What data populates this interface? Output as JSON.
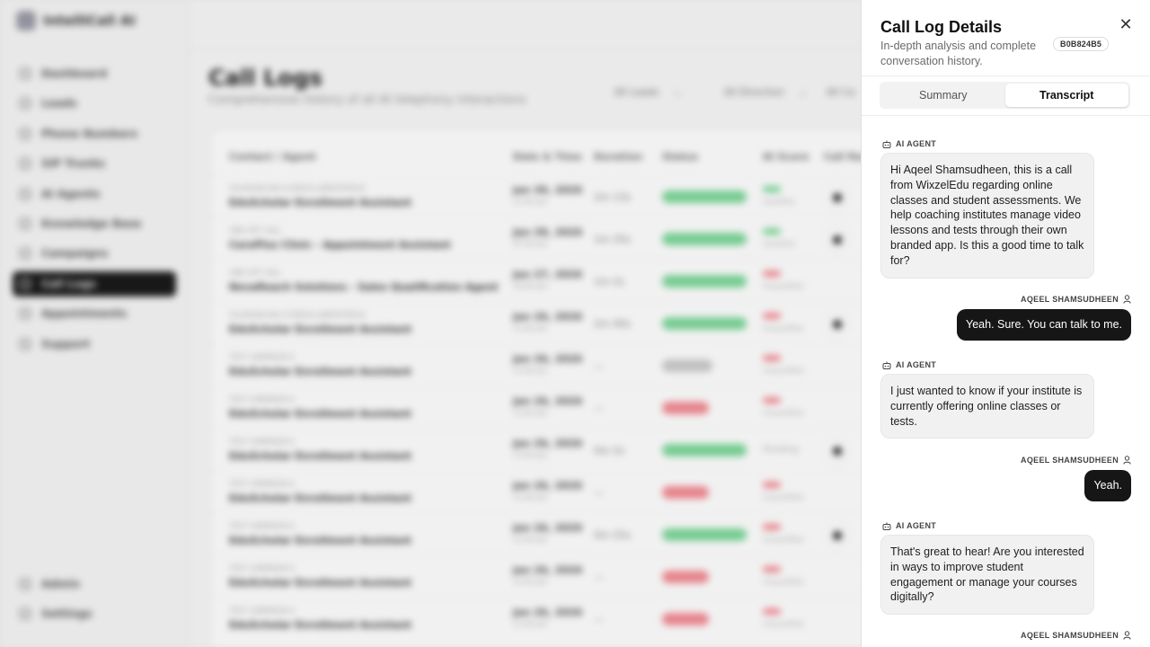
{
  "background": {
    "brand": "IntelliCall AI",
    "nav": [
      "Dashboard",
      "Leads",
      "Phone Numbers",
      "SIP Trunks",
      "AI Agents",
      "Knowledge Base",
      "Campaigns",
      "Call Logs",
      "Appointments",
      "Support"
    ],
    "nav_active_index": 7,
    "nav_bottom": [
      "Admin",
      "Settings"
    ],
    "page_title": "Call Logs",
    "page_subtitle": "Comprehensive history of all AI telephony interactions",
    "filters": [
      "All Leads",
      "All Direction",
      "All Ca"
    ],
    "table_headers": [
      "Contact / Agent",
      "Date & Time",
      "Duration",
      "Status",
      "AI Score",
      "Call Rec"
    ],
    "rows": [
      {
        "contact": "SOUDHAVLAN (CONSOLLANDOFDEUD",
        "agent": "EduScholar Enrollment Assistant",
        "date": "Jan 30, 2026",
        "time": "11:42 pm",
        "duration": "2m 13s",
        "status": "ok",
        "score": "g",
        "rec": true
      },
      {
        "contact": "ONE-OFF CALL",
        "agent": "CarePlus Clinic - Appointment Assistant",
        "date": "Jan 28, 2026",
        "time": "07:55 pm",
        "duration": "1m 35s",
        "status": "ok",
        "score": "g",
        "rec": true
      },
      {
        "contact": "ONE-OFF CALL",
        "agent": "NovaReach Solutions - Sales Qualification Agent",
        "date": "Jan 27, 2026",
        "time": "10:45 pm",
        "duration": "1m 2s",
        "status": "ok",
        "score": "r",
        "rec": false
      },
      {
        "contact": "SOUDHAVLAN (CONSOLLANDOFDEUD",
        "agent": "EduScholar Enrollment Assistant",
        "date": "Jan 26, 2026",
        "time": "11:42 pm",
        "duration": "2m 40s",
        "status": "ok",
        "score": "r",
        "rec": true
      },
      {
        "contact": "TEST CAMPAIGN A",
        "agent": "EduScholar Enrollment Assistant",
        "date": "Jan 26, 2026",
        "time": "11:42 pm",
        "duration": "—",
        "status": "na",
        "score": "r",
        "rec": false
      },
      {
        "contact": "TEST CAMPAIGN A",
        "agent": "EduScholar Enrollment Assistant",
        "date": "Jan 26, 2026",
        "time": "11:42 pm",
        "duration": "—",
        "status": "bad",
        "score": "r",
        "rec": false
      },
      {
        "contact": "TEST CAMPAIGN A",
        "agent": "EduScholar Enrollment Assistant",
        "date": "Jan 26, 2026",
        "time": "11:42 pm",
        "duration": "0m 2s",
        "status": "ok",
        "score": "n",
        "rec": true
      },
      {
        "contact": "TEST CAMPAIGN A",
        "agent": "EduScholar Enrollment Assistant",
        "date": "Jan 26, 2026",
        "time": "11:42 pm",
        "duration": "—",
        "status": "bad",
        "score": "r",
        "rec": false
      },
      {
        "contact": "TEST CAMPAIGN A",
        "agent": "EduScholar Enrollment Assistant",
        "date": "Jan 26, 2026",
        "time": "11:42 pm",
        "duration": "0m 25s",
        "status": "ok",
        "score": "r",
        "rec": true
      },
      {
        "contact": "TEST CAMPAIGN A",
        "agent": "EduScholar Enrollment Assistant",
        "date": "Jan 26, 2026",
        "time": "11:42 pm",
        "duration": "—",
        "status": "bad",
        "score": "r",
        "rec": false
      },
      {
        "contact": "TEST CAMPAIGN A",
        "agent": "EduScholar Enrollment Assistant",
        "date": "Jan 26, 2026",
        "time": "11:42 pm",
        "duration": "—",
        "status": "bad",
        "score": "r",
        "rec": false
      }
    ]
  },
  "drawer": {
    "title": "Call Log Details",
    "subtitle": "In-depth analysis and complete conversation history.",
    "call_id": "B0B824B5",
    "close_icon": "close-icon",
    "tabs": [
      {
        "label": "Summary",
        "active": false
      },
      {
        "label": "Transcript",
        "active": true
      }
    ],
    "messages": [
      {
        "role": "agent",
        "speaker": "AI AGENT",
        "text": "Hi Aqeel Shamsudheen, this is a call from WixzelEdu regarding online classes and student assessments. We help coaching institutes manage video lessons and tests through their own branded app. Is this a good time to talk for?"
      },
      {
        "role": "user",
        "speaker": "AQEEL SHAMSUDHEEN",
        "text": "Yeah. Sure. You can talk to me."
      },
      {
        "role": "agent",
        "speaker": "AI AGENT",
        "text": "I just wanted to know if your institute is currently offering online classes or tests."
      },
      {
        "role": "user",
        "speaker": "AQEEL SHAMSUDHEEN",
        "text": "Yeah."
      },
      {
        "role": "agent",
        "speaker": "AI AGENT",
        "text": "That's great to hear! Are you interested in ways to improve student engagement or manage your courses digitally?"
      },
      {
        "role": "user",
        "speaker": "AQEEL SHAMSUDHEEN",
        "text": ""
      }
    ]
  }
}
